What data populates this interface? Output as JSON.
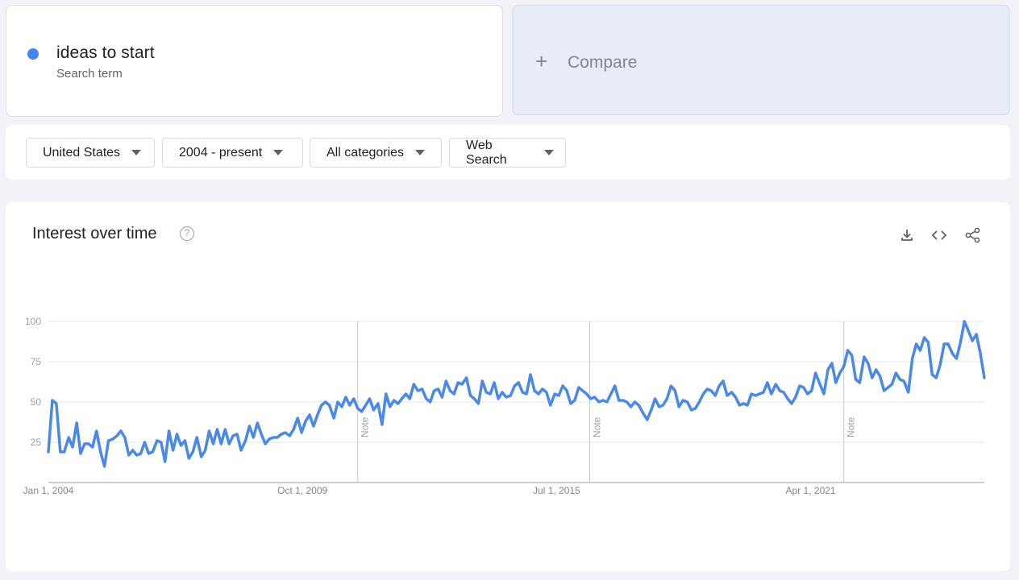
{
  "search_term": {
    "name": "ideas to start",
    "subtitle": "Search term",
    "color": "#4285f4"
  },
  "compare": {
    "plus": "+",
    "label": "Compare"
  },
  "filters": [
    {
      "label": "United States",
      "icon": "caret-down-icon"
    },
    {
      "label": "2004 - present",
      "icon": "caret-down-icon"
    },
    {
      "label": "All categories",
      "icon": "caret-down-icon"
    },
    {
      "label": "Web Search",
      "icon": "caret-down-icon"
    }
  ],
  "interest": {
    "title": "Interest over time",
    "help_icon": "help-icon",
    "help_glyph": "?",
    "tools": [
      "download-icon",
      "embed-icon",
      "share-icon"
    ]
  },
  "chart_data": {
    "type": "line",
    "series_color": "#4a89e8",
    "ylim": [
      0,
      100
    ],
    "yticks": [
      25,
      50,
      75,
      100
    ],
    "xlim": [
      "2004-01",
      "2025-01"
    ],
    "xticks": [
      {
        "label": "Jan 1, 2004",
        "date": "2004-01"
      },
      {
        "label": "Oct 1, 2009",
        "date": "2009-10"
      },
      {
        "label": "Jul 1, 2015",
        "date": "2015-07"
      },
      {
        "label": "Apr 1, 2021",
        "date": "2021-04"
      }
    ],
    "notes": [
      {
        "label": "Note",
        "date": "2011-01"
      },
      {
        "label": "Note",
        "date": "2016-04"
      },
      {
        "label": "Note",
        "date": "2022-01"
      }
    ],
    "grid": true,
    "series": [
      {
        "values": [
          [
            2004.0,
            19
          ],
          [
            2004.09,
            51
          ],
          [
            2004.18,
            49
          ],
          [
            2004.27,
            19
          ],
          [
            2004.36,
            19
          ],
          [
            2004.46,
            28
          ],
          [
            2004.55,
            22
          ],
          [
            2004.64,
            37
          ],
          [
            2004.73,
            18
          ],
          [
            2004.82,
            24
          ],
          [
            2004.91,
            24
          ],
          [
            2005.0,
            22
          ],
          [
            2005.09,
            32
          ],
          [
            2005.18,
            19
          ],
          [
            2005.27,
            10
          ],
          [
            2005.36,
            26
          ],
          [
            2005.46,
            27
          ],
          [
            2005.55,
            29
          ],
          [
            2005.64,
            32
          ],
          [
            2005.73,
            28
          ],
          [
            2005.82,
            17
          ],
          [
            2005.91,
            20
          ],
          [
            2006.0,
            17
          ],
          [
            2006.09,
            18
          ],
          [
            2006.18,
            25
          ],
          [
            2006.27,
            18
          ],
          [
            2006.36,
            19
          ],
          [
            2006.46,
            26
          ],
          [
            2006.55,
            25
          ],
          [
            2006.64,
            13
          ],
          [
            2006.73,
            32
          ],
          [
            2006.82,
            20
          ],
          [
            2006.91,
            30
          ],
          [
            2007.0,
            23
          ],
          [
            2007.09,
            26
          ],
          [
            2007.18,
            15
          ],
          [
            2007.27,
            19
          ],
          [
            2007.36,
            28
          ],
          [
            2007.46,
            16
          ],
          [
            2007.55,
            20
          ],
          [
            2007.64,
            32
          ],
          [
            2007.73,
            24
          ],
          [
            2007.82,
            33
          ],
          [
            2007.91,
            24
          ],
          [
            2008.0,
            33
          ],
          [
            2008.09,
            24
          ],
          [
            2008.18,
            29
          ],
          [
            2008.27,
            30
          ],
          [
            2008.36,
            20
          ],
          [
            2008.46,
            26
          ],
          [
            2008.55,
            35
          ],
          [
            2008.64,
            28
          ],
          [
            2008.73,
            37
          ],
          [
            2008.82,
            30
          ],
          [
            2008.91,
            24
          ],
          [
            2009.0,
            27
          ],
          [
            2009.09,
            28
          ],
          [
            2009.18,
            28
          ],
          [
            2009.27,
            30
          ],
          [
            2009.36,
            31
          ],
          [
            2009.46,
            29
          ],
          [
            2009.55,
            33
          ],
          [
            2009.64,
            40
          ],
          [
            2009.73,
            31
          ],
          [
            2009.82,
            38
          ],
          [
            2009.91,
            42
          ],
          [
            2010.0,
            35
          ],
          [
            2010.09,
            42
          ],
          [
            2010.18,
            48
          ],
          [
            2010.27,
            50
          ],
          [
            2010.36,
            48
          ],
          [
            2010.46,
            40
          ],
          [
            2010.55,
            50
          ],
          [
            2010.64,
            47
          ],
          [
            2010.73,
            53
          ],
          [
            2010.82,
            48
          ],
          [
            2010.91,
            52
          ],
          [
            2011.0,
            46
          ],
          [
            2011.09,
            44
          ],
          [
            2011.18,
            48
          ],
          [
            2011.27,
            52
          ],
          [
            2011.36,
            45
          ],
          [
            2011.46,
            49
          ],
          [
            2011.55,
            36
          ],
          [
            2011.64,
            55
          ],
          [
            2011.73,
            47
          ],
          [
            2011.82,
            51
          ],
          [
            2011.91,
            49
          ],
          [
            2012.0,
            52
          ],
          [
            2012.09,
            55
          ],
          [
            2012.18,
            52
          ],
          [
            2012.27,
            61
          ],
          [
            2012.36,
            57
          ],
          [
            2012.46,
            58
          ],
          [
            2012.55,
            52
          ],
          [
            2012.64,
            50
          ],
          [
            2012.73,
            57
          ],
          [
            2012.82,
            58
          ],
          [
            2012.91,
            53
          ],
          [
            2013.0,
            63
          ],
          [
            2013.09,
            57
          ],
          [
            2013.18,
            55
          ],
          [
            2013.27,
            62
          ],
          [
            2013.36,
            61
          ],
          [
            2013.46,
            65
          ],
          [
            2013.55,
            54
          ],
          [
            2013.64,
            52
          ],
          [
            2013.73,
            49
          ],
          [
            2013.82,
            63
          ],
          [
            2013.91,
            56
          ],
          [
            2014.0,
            55
          ],
          [
            2014.09,
            62
          ],
          [
            2014.18,
            52
          ],
          [
            2014.27,
            56
          ],
          [
            2014.36,
            53
          ],
          [
            2014.46,
            54
          ],
          [
            2014.55,
            60
          ],
          [
            2014.64,
            62
          ],
          [
            2014.73,
            56
          ],
          [
            2014.82,
            55
          ],
          [
            2014.91,
            67
          ],
          [
            2015.0,
            57
          ],
          [
            2015.09,
            55
          ],
          [
            2015.18,
            58
          ],
          [
            2015.27,
            56
          ],
          [
            2015.36,
            48
          ],
          [
            2015.46,
            55
          ],
          [
            2015.55,
            54
          ],
          [
            2015.64,
            60
          ],
          [
            2015.73,
            57
          ],
          [
            2015.82,
            49
          ],
          [
            2015.91,
            51
          ],
          [
            2016.0,
            59
          ],
          [
            2016.09,
            57
          ],
          [
            2016.18,
            55
          ],
          [
            2016.27,
            52
          ],
          [
            2016.36,
            53
          ],
          [
            2016.46,
            50
          ],
          [
            2016.55,
            51
          ],
          [
            2016.64,
            50
          ],
          [
            2016.73,
            55
          ],
          [
            2016.82,
            60
          ],
          [
            2016.91,
            51
          ],
          [
            2017.0,
            51
          ],
          [
            2017.09,
            50
          ],
          [
            2017.18,
            47
          ],
          [
            2017.27,
            50
          ],
          [
            2017.36,
            48
          ],
          [
            2017.46,
            43
          ],
          [
            2017.55,
            39
          ],
          [
            2017.64,
            45
          ],
          [
            2017.73,
            52
          ],
          [
            2017.82,
            47
          ],
          [
            2017.91,
            48
          ],
          [
            2018.0,
            52
          ],
          [
            2018.09,
            60
          ],
          [
            2018.18,
            57
          ],
          [
            2018.27,
            47
          ],
          [
            2018.36,
            51
          ],
          [
            2018.46,
            50
          ],
          [
            2018.55,
            45
          ],
          [
            2018.64,
            46
          ],
          [
            2018.73,
            50
          ],
          [
            2018.82,
            55
          ],
          [
            2018.91,
            58
          ],
          [
            2019.0,
            57
          ],
          [
            2019.09,
            54
          ],
          [
            2019.18,
            60
          ],
          [
            2019.27,
            63
          ],
          [
            2019.36,
            54
          ],
          [
            2019.46,
            56
          ],
          [
            2019.55,
            53
          ],
          [
            2019.64,
            48
          ],
          [
            2019.73,
            49
          ],
          [
            2019.82,
            48
          ],
          [
            2019.91,
            55
          ],
          [
            2020.0,
            54
          ],
          [
            2020.09,
            55
          ],
          [
            2020.18,
            56
          ],
          [
            2020.27,
            62
          ],
          [
            2020.36,
            55
          ],
          [
            2020.46,
            61
          ],
          [
            2020.55,
            57
          ],
          [
            2020.64,
            56
          ],
          [
            2020.73,
            52
          ],
          [
            2020.82,
            49
          ],
          [
            2020.91,
            53
          ],
          [
            2021.0,
            60
          ],
          [
            2021.09,
            59
          ],
          [
            2021.18,
            55
          ],
          [
            2021.27,
            57
          ],
          [
            2021.36,
            68
          ],
          [
            2021.46,
            61
          ],
          [
            2021.55,
            55
          ],
          [
            2021.64,
            70
          ],
          [
            2021.73,
            74
          ],
          [
            2021.82,
            62
          ],
          [
            2021.91,
            68
          ],
          [
            2022.0,
            72
          ],
          [
            2022.09,
            82
          ],
          [
            2022.18,
            79
          ],
          [
            2022.27,
            64
          ],
          [
            2022.36,
            62
          ],
          [
            2022.46,
            78
          ],
          [
            2022.55,
            74
          ],
          [
            2022.64,
            65
          ],
          [
            2022.73,
            70
          ],
          [
            2022.82,
            66
          ],
          [
            2022.91,
            57
          ],
          [
            2023.0,
            59
          ],
          [
            2023.09,
            61
          ],
          [
            2023.18,
            68
          ],
          [
            2023.27,
            64
          ],
          [
            2023.36,
            63
          ],
          [
            2023.46,
            56
          ],
          [
            2023.55,
            77
          ],
          [
            2023.64,
            86
          ],
          [
            2023.73,
            82
          ],
          [
            2023.82,
            90
          ],
          [
            2023.91,
            87
          ],
          [
            2024.0,
            67
          ],
          [
            2024.09,
            65
          ],
          [
            2024.18,
            73
          ],
          [
            2024.27,
            86
          ],
          [
            2024.36,
            86
          ],
          [
            2024.46,
            80
          ],
          [
            2024.55,
            77
          ],
          [
            2024.64,
            87
          ],
          [
            2024.73,
            100
          ],
          [
            2024.82,
            94
          ],
          [
            2024.91,
            88
          ],
          [
            2025.0,
            92
          ],
          [
            2025.09,
            80
          ],
          [
            2025.18,
            65
          ]
        ]
      }
    ]
  }
}
